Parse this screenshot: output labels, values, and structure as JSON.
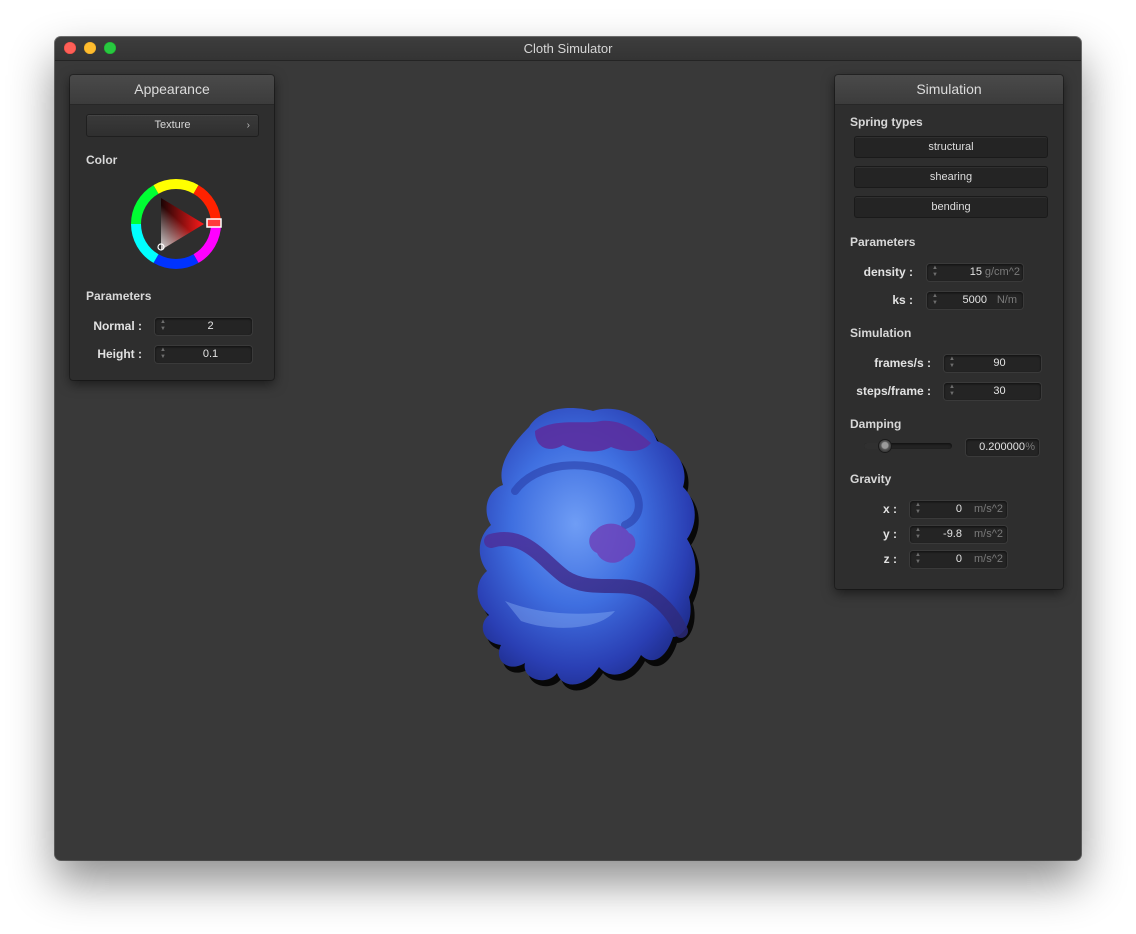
{
  "window": {
    "title": "Cloth Simulator"
  },
  "appearance": {
    "title": "Appearance",
    "shader_select": "Texture",
    "color_label": "Color",
    "parameters_label": "Parameters",
    "normal": {
      "label": "Normal :",
      "value": "2"
    },
    "height": {
      "label": "Height :",
      "value": "0.1"
    }
  },
  "simulation": {
    "title": "Simulation",
    "spring_types_label": "Spring types",
    "springs": [
      "structural",
      "shearing",
      "bending"
    ],
    "parameters_label": "Parameters",
    "density": {
      "label": "density :",
      "value": "15",
      "unit": "g/cm^2"
    },
    "ks": {
      "label": "ks :",
      "value": "5000",
      "unit": "N/m"
    },
    "simulation_label": "Simulation",
    "frames": {
      "label": "frames/s :",
      "value": "90"
    },
    "steps": {
      "label": "steps/frame :",
      "value": "30"
    },
    "damping_label": "Damping",
    "damping": {
      "value": "0.200000",
      "unit": "%",
      "slider_fraction": 0.2
    },
    "gravity_label": "Gravity",
    "gx": {
      "label": "x :",
      "value": "0",
      "unit": "m/s^2"
    },
    "gy": {
      "label": "y :",
      "value": "-9.8",
      "unit": "m/s^2"
    },
    "gz": {
      "label": "z :",
      "value": "0",
      "unit": "m/s^2"
    }
  },
  "colors": {
    "selected_color": "#ff1a1a",
    "cloth_primary": "#3f6fe0",
    "cloth_accent": "#6a2ea8"
  }
}
